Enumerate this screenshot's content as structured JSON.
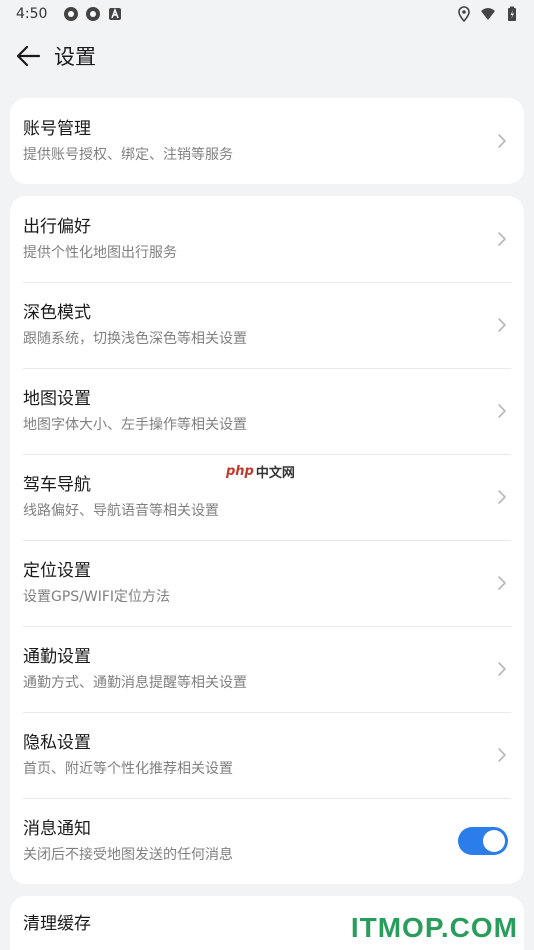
{
  "status_bar": {
    "time": "4:50"
  },
  "header": {
    "title": "设置"
  },
  "account_card": {
    "title": "账号管理",
    "subtitle": "提供账号授权、绑定、注销等服务"
  },
  "settings": [
    {
      "title": "出行偏好",
      "subtitle": "提供个性化地图出行服务"
    },
    {
      "title": "深色模式",
      "subtitle": "跟随系统，切换浅色深色等相关设置"
    },
    {
      "title": "地图设置",
      "subtitle": "地图字体大小、左手操作等相关设置"
    },
    {
      "title": "驾车导航",
      "subtitle": "线路偏好、导航语音等相关设置"
    },
    {
      "title": "定位设置",
      "subtitle": "设置GPS/WIFI定位方法"
    },
    {
      "title": "通勤设置",
      "subtitle": "通勤方式、通勤消息提醒等相关设置"
    },
    {
      "title": "隐私设置",
      "subtitle": "首页、附近等个性化推荐相关设置"
    }
  ],
  "notification": {
    "title": "消息通知",
    "subtitle": "关闭后不接受地图发送的任何消息",
    "enabled": true
  },
  "cache": {
    "title": "清理缓存"
  },
  "watermarks": {
    "php_badge": "php",
    "php_text": "中文网",
    "itmop": "ITMOP.COM"
  },
  "colors": {
    "background": "#f1f3f5",
    "card": "#ffffff",
    "toggle_on": "#2b7de9",
    "subtitle": "#808080",
    "itmop_green": "#2a9d5c"
  }
}
